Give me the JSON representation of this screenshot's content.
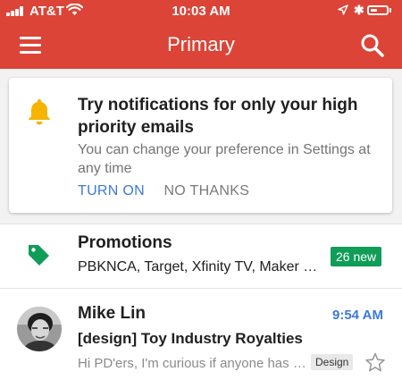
{
  "status_bar": {
    "carrier": "AT&T",
    "time": "10:03 AM",
    "bluetooth_glyph": "✱"
  },
  "header": {
    "title": "Primary",
    "menu_icon": "menu-icon",
    "search_icon": "search-icon",
    "color": "#db4437"
  },
  "promo_card": {
    "icon": "bell-icon",
    "icon_color": "#f4b400",
    "title": "Try notifications for only your high priority emails",
    "body": "You can change your preference in Settings at any time",
    "primary_action": "TURN ON",
    "secondary_action": "NO THANKS"
  },
  "categories": [
    {
      "title": "Promotions",
      "snippet": "PBKNCA, Target, Xfinity TV, Maker F...",
      "badge": "26 new",
      "icon": "tag-icon",
      "icon_color": "#0f9d58"
    }
  ],
  "emails": [
    {
      "sender": "Mike Lin",
      "time": "9:54 AM",
      "subject": "[design] Toy Industry Royalties",
      "preview": "Hi PD'ers, I'm curious if anyone has e...",
      "label": "Design",
      "starred": false
    }
  ],
  "colors": {
    "accent_blue": "#3d7ad6",
    "badge_green": "#0f9d58"
  }
}
